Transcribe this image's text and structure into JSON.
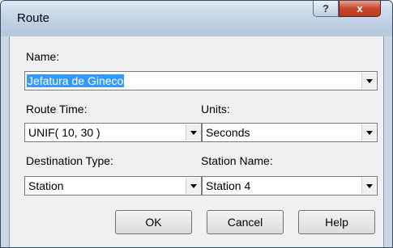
{
  "window": {
    "title": "Route",
    "help_glyph": "?",
    "close_glyph": "x"
  },
  "fields": {
    "name": {
      "label": "Name:",
      "value": "Jefatura de Gineco"
    },
    "route_time": {
      "label": "Route Time:",
      "value": "UNIF( 10, 30 )"
    },
    "units": {
      "label": "Units:",
      "value": "Seconds"
    },
    "destination_type": {
      "label": "Destination Type:",
      "value": "Station"
    },
    "station_name": {
      "label": "Station Name:",
      "value": "Station 4"
    }
  },
  "buttons": {
    "ok": "OK",
    "cancel": "Cancel",
    "help": "Help"
  },
  "icons": {
    "dropdown": "chevron-down-icon"
  }
}
